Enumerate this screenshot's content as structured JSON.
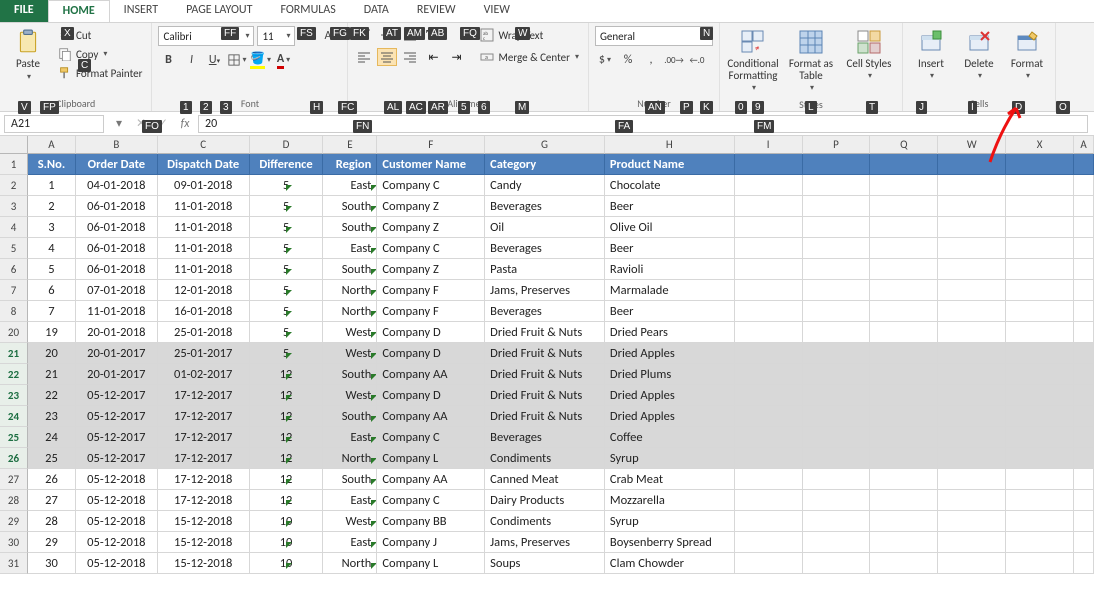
{
  "tabs": {
    "file": "FILE",
    "home": "HOME",
    "insert": "INSERT",
    "pagelayout": "PAGE LAYOUT",
    "formulas": "FORMULAS",
    "data": "DATA",
    "review": "REVIEW",
    "view": "VIEW"
  },
  "ribbon": {
    "clipboard": {
      "paste": "Paste",
      "cut": "Cut",
      "copy": "Copy",
      "format_painter": "Format Painter",
      "title": "Clipboard"
    },
    "font": {
      "name": "Calibri",
      "size": "11",
      "title": "Font"
    },
    "alignment": {
      "wrap": "Wrap Text",
      "merge": "Merge & Center",
      "title": "Alignment"
    },
    "number": {
      "format": "General",
      "title": "Number"
    },
    "styles": {
      "cond": "Conditional Formatting",
      "table": "Format as Table",
      "cell": "Cell Styles",
      "title": "Styles"
    },
    "cells": {
      "insert": "Insert",
      "delete": "Delete",
      "format": "Format",
      "title": "Cells"
    }
  },
  "keytips": {
    "file_x": "X",
    "ff": "FF",
    "fs": "FS",
    "fg": "FG",
    "fk": "FK",
    "at": "AT",
    "am": "AM",
    "ab": "AB",
    "fq": "FQ",
    "w": "W",
    "n": "N",
    "c": "C",
    "v": "V",
    "fp": "FP",
    "fo": "FO",
    "fn_title": "FN",
    "one": "1",
    "two": "2",
    "three": "3",
    "h": "H",
    "fc": "FC",
    "al": "AL",
    "ac": "AC",
    "ar": "AR",
    "five": "5",
    "six": "6",
    "m": "M",
    "fa": "FA",
    "an": "AN",
    "p": "P",
    "k": "K",
    "zero": "0",
    "nine": "9",
    "fm": "FM",
    "l": "L",
    "t": "T",
    "j": "J",
    "i": "I",
    "d": "D",
    "o": "O"
  },
  "fxbar": {
    "namebox": "A21",
    "fx_icon": "fx",
    "formula": "20"
  },
  "columns": [
    "A",
    "B",
    "C",
    "D",
    "E",
    "F",
    "G",
    "H",
    "I",
    "P",
    "Q",
    "W",
    "X",
    "A"
  ],
  "col_classes": [
    "cA",
    "cB",
    "cC",
    "cD",
    "cE",
    "cF",
    "cG",
    "cH",
    "cI",
    "cP",
    "cQ",
    "cW",
    "cX",
    "cAend"
  ],
  "header_row": {
    "row_num": 1,
    "cells": [
      "S.No.",
      "Order Date",
      "Dispatch Date",
      "Difference",
      "Region",
      "Customer Name",
      "Category",
      "Product Name"
    ]
  },
  "rows": [
    {
      "rn": 2,
      "sel": false,
      "c": [
        "1",
        "04-01-2018",
        "09-01-2018",
        "5",
        "East",
        "Company C",
        "Candy",
        "Chocolate"
      ]
    },
    {
      "rn": 3,
      "sel": false,
      "c": [
        "2",
        "06-01-2018",
        "11-01-2018",
        "5",
        "South",
        "Company Z",
        "Beverages",
        "Beer"
      ]
    },
    {
      "rn": 4,
      "sel": false,
      "c": [
        "3",
        "06-01-2018",
        "11-01-2018",
        "5",
        "South",
        "Company Z",
        "Oil",
        "Olive Oil"
      ]
    },
    {
      "rn": 5,
      "sel": false,
      "c": [
        "4",
        "06-01-2018",
        "11-01-2018",
        "5",
        "East",
        "Company C",
        "Beverages",
        "Beer"
      ]
    },
    {
      "rn": 6,
      "sel": false,
      "c": [
        "5",
        "06-01-2018",
        "11-01-2018",
        "5",
        "South",
        "Company Z",
        "Pasta",
        "Ravioli"
      ]
    },
    {
      "rn": 7,
      "sel": false,
      "c": [
        "6",
        "07-01-2018",
        "12-01-2018",
        "5",
        "North",
        "Company F",
        "Jams, Preserves",
        "Marmalade"
      ]
    },
    {
      "rn": 8,
      "sel": false,
      "c": [
        "7",
        "11-01-2018",
        "16-01-2018",
        "5",
        "North",
        "Company F",
        "Beverages",
        "Beer"
      ]
    },
    {
      "rn": 20,
      "sel": false,
      "c": [
        "19",
        "20-01-2018",
        "25-01-2018",
        "5",
        "West",
        "Company D",
        "Dried Fruit & Nuts",
        "Dried Pears"
      ]
    },
    {
      "rn": 21,
      "sel": true,
      "c": [
        "20",
        "20-01-2017",
        "25-01-2017",
        "5",
        "West",
        "Company D",
        "Dried Fruit & Nuts",
        "Dried Apples"
      ]
    },
    {
      "rn": 22,
      "sel": true,
      "c": [
        "21",
        "20-01-2017",
        "01-02-2017",
        "12",
        "South",
        "Company AA",
        "Dried Fruit & Nuts",
        "Dried Plums"
      ]
    },
    {
      "rn": 23,
      "sel": true,
      "c": [
        "22",
        "05-12-2017",
        "17-12-2017",
        "12",
        "West",
        "Company D",
        "Dried Fruit & Nuts",
        "Dried Apples"
      ]
    },
    {
      "rn": 24,
      "sel": true,
      "c": [
        "23",
        "05-12-2017",
        "17-12-2017",
        "12",
        "South",
        "Company AA",
        "Dried Fruit & Nuts",
        "Dried Apples"
      ]
    },
    {
      "rn": 25,
      "sel": true,
      "c": [
        "24",
        "05-12-2017",
        "17-12-2017",
        "12",
        "East",
        "Company C",
        "Beverages",
        "Coffee"
      ]
    },
    {
      "rn": 26,
      "sel": true,
      "c": [
        "25",
        "05-12-2017",
        "17-12-2017",
        "12",
        "North",
        "Company L",
        "Condiments",
        "Syrup"
      ]
    },
    {
      "rn": 27,
      "sel": false,
      "c": [
        "26",
        "05-12-2018",
        "17-12-2018",
        "12",
        "South",
        "Company AA",
        "Canned Meat",
        "Crab Meat"
      ]
    },
    {
      "rn": 28,
      "sel": false,
      "c": [
        "27",
        "05-12-2018",
        "17-12-2018",
        "12",
        "East",
        "Company C",
        "Dairy Products",
        "Mozzarella"
      ]
    },
    {
      "rn": 29,
      "sel": false,
      "c": [
        "28",
        "05-12-2018",
        "15-12-2018",
        "10",
        "West",
        "Company BB",
        "Condiments",
        "Syrup"
      ]
    },
    {
      "rn": 30,
      "sel": false,
      "c": [
        "29",
        "05-12-2018",
        "15-12-2018",
        "10",
        "East",
        "Company J",
        "Jams, Preserves",
        "Boysenberry Spread"
      ]
    },
    {
      "rn": 31,
      "sel": false,
      "c": [
        "30",
        "05-12-2018",
        "15-12-2018",
        "10",
        "North",
        "Company L",
        "Soups",
        "Clam Chowder"
      ]
    }
  ],
  "cell_aligns": [
    "center",
    "center",
    "center",
    "center",
    "right",
    "left",
    "left",
    "left"
  ]
}
